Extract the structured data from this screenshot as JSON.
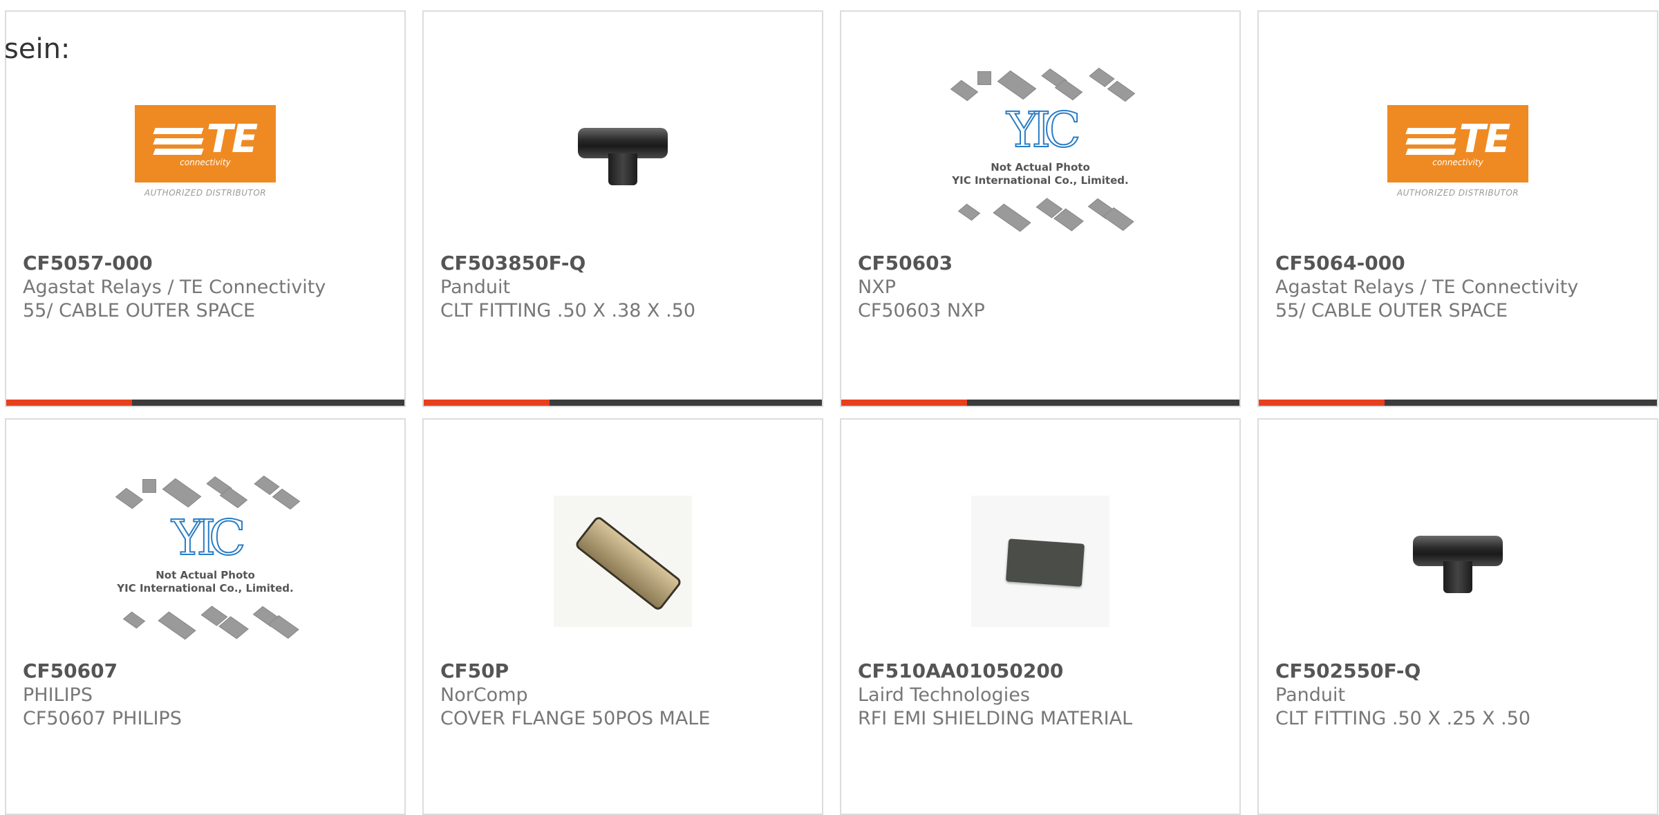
{
  "prefix_text": "sein:",
  "accent_color": "#e8401c",
  "te_logo": {
    "mark": "TE",
    "sub": "connectivity",
    "dist": "AUTHORIZED DISTRIBUTOR"
  },
  "yic_placeholder": {
    "logo": "YIC",
    "line1": "Not Actual Photo",
    "line2": "YIC International Co., Limited."
  },
  "products": [
    {
      "part_number": "CF5057-000",
      "manufacturer": "Agastat Relays / TE Connectivity",
      "description": "55/ CABLE OUTER SPACE",
      "image": "te-logo"
    },
    {
      "part_number": "CF503850F-Q",
      "manufacturer": "Panduit",
      "description": "CLT FITTING .50 X .38 X .50",
      "image": "tee-fitting"
    },
    {
      "part_number": "CF50603",
      "manufacturer": "NXP",
      "description": "CF50603 NXP",
      "image": "yic-placeholder"
    },
    {
      "part_number": "CF5064-000",
      "manufacturer": "Agastat Relays / TE Connectivity",
      "description": "55/ CABLE OUTER SPACE",
      "image": "te-logo"
    },
    {
      "part_number": "CF50607",
      "manufacturer": "PHILIPS",
      "description": "CF50607 PHILIPS",
      "image": "yic-placeholder"
    },
    {
      "part_number": "CF50P",
      "manufacturer": "NorComp",
      "description": "COVER FLANGE 50POS MALE",
      "image": "dsub-connector"
    },
    {
      "part_number": "CF510AA01050200",
      "manufacturer": "Laird Technologies",
      "description": "RFI EMI SHIELDING MATERIAL",
      "image": "foam-pad"
    },
    {
      "part_number": "CF502550F-Q",
      "manufacturer": "Panduit",
      "description": "CLT FITTING .50 X .25 X .50",
      "image": "tee-fitting"
    }
  ]
}
